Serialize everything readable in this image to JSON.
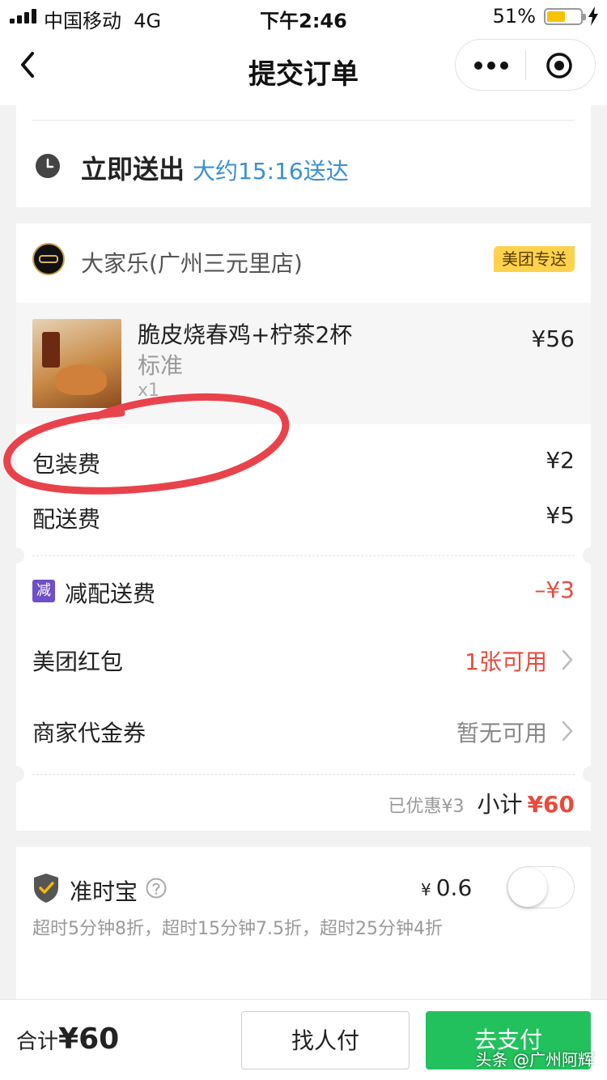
{
  "status_bar": {
    "carrier": "中国移动",
    "network": "4G",
    "time": "下午2:46",
    "battery": "51%"
  },
  "nav": {
    "title": "提交订单"
  },
  "delivery": {
    "title": "立即送出",
    "eta": "大约15:16送达"
  },
  "store": {
    "name": "大家乐(广州三元里店)",
    "badge": "美团专送"
  },
  "product": {
    "name": "脆皮烧春鸡+柠茶2杯",
    "spec": "标准",
    "qty": "x1",
    "price": "¥56"
  },
  "fees": [
    {
      "label": "包装费",
      "value": "¥2"
    },
    {
      "label": "配送费",
      "value": "¥5"
    }
  ],
  "discount": {
    "tag": "减",
    "label": "减配送费",
    "value": "–¥3"
  },
  "coupons": [
    {
      "label": "美团红包",
      "value": "1张可用"
    },
    {
      "label": "商家代金券",
      "value": "暂无可用"
    }
  ],
  "subtotal": {
    "saved": "已优惠¥3",
    "label": "小计",
    "value": "¥60"
  },
  "insurance": {
    "title": "准时宝",
    "currency": "¥",
    "price": "0.6",
    "description": "超时5分钟8折，超时15分钟7.5折，超时25分钟4折",
    "toggle_on": false
  },
  "bottom": {
    "total_label": "合计",
    "total_value": "¥60",
    "friend_pay": "找人付",
    "pay": "去支付",
    "watermark": "头条 @广州阿辉"
  },
  "colors": {
    "accent_blue": "#3a8fd6",
    "price_red": "#e64b3c",
    "pay_green": "#22c15e",
    "badge_yellow": "#ffd24d",
    "annotation_red": "#e8434b"
  }
}
